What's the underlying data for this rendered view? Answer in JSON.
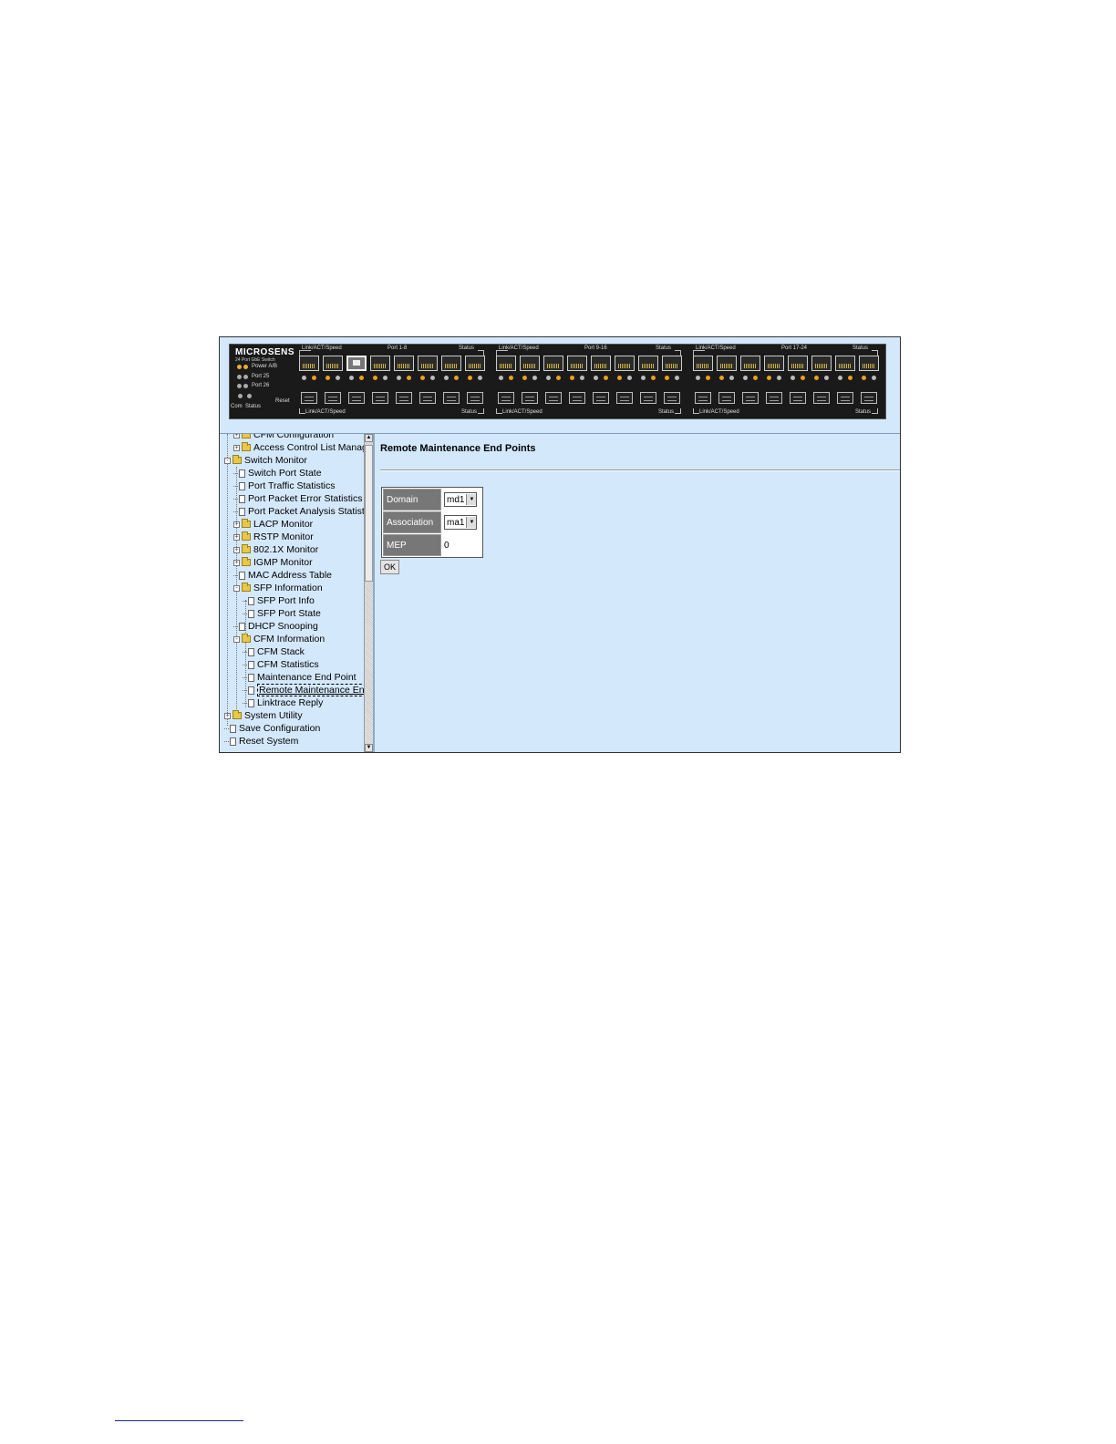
{
  "banner": {
    "brand": "MICROSENS",
    "subtitle": "24 Port GbE Switch",
    "power_label": "Power A/B",
    "port25_label": "Port 25",
    "port26_label": "Port 26",
    "com_label": "Com",
    "status_label": "Status",
    "reset_label": "Reset",
    "groups": [
      {
        "top_left": "Link/ACT/Speed",
        "top_center": "Port 1-8",
        "top_right": "Status",
        "bottom_left": "Link/ACT/Speed",
        "bottom_right": "Status"
      },
      {
        "top_left": "Link/ACT/Speed",
        "top_center": "Port 9-16",
        "top_right": "Status",
        "bottom_left": "Link/ACT/Speed",
        "bottom_right": "Status"
      },
      {
        "top_left": "Link/ACT/Speed",
        "top_center": "Port 17-24",
        "top_right": "Status",
        "bottom_left": "Link/ACT/Speed",
        "bottom_right": "Status"
      }
    ]
  },
  "tree": {
    "items": [
      {
        "label": "CFM Configuration",
        "type": "folder",
        "expander": "+"
      },
      {
        "label": "Access Control List Manage",
        "type": "folder",
        "expander": "+"
      },
      {
        "label": "Switch Monitor",
        "type": "folder",
        "expander": "-"
      },
      {
        "label": "Switch Port State",
        "type": "page"
      },
      {
        "label": "Port Traffic Statistics",
        "type": "page"
      },
      {
        "label": "Port Packet Error Statistics",
        "type": "page"
      },
      {
        "label": "Port Packet Analysis Statist",
        "type": "page"
      },
      {
        "label": "LACP Monitor",
        "type": "folder",
        "expander": "+"
      },
      {
        "label": "RSTP Monitor",
        "type": "folder",
        "expander": "+"
      },
      {
        "label": "802.1X Monitor",
        "type": "folder",
        "expander": "+"
      },
      {
        "label": "IGMP Monitor",
        "type": "folder",
        "expander": "+"
      },
      {
        "label": "MAC Address Table",
        "type": "page"
      },
      {
        "label": "SFP Information",
        "type": "folder",
        "expander": "-"
      },
      {
        "label": "SFP Port Info",
        "type": "page"
      },
      {
        "label": "SFP Port State",
        "type": "page"
      },
      {
        "label": "DHCP Snooping",
        "type": "page"
      },
      {
        "label": "CFM Information",
        "type": "folder",
        "expander": "-"
      },
      {
        "label": "CFM Stack",
        "type": "page"
      },
      {
        "label": "CFM Statistics",
        "type": "page"
      },
      {
        "label": "Maintenance End Point",
        "type": "page"
      },
      {
        "label": "Remote Maintenance End",
        "type": "page",
        "active": true
      },
      {
        "label": "Linktrace Reply",
        "type": "page"
      },
      {
        "label": "System Utility",
        "type": "folder",
        "expander": "+"
      },
      {
        "label": "Save Configuration",
        "type": "page"
      },
      {
        "label": "Reset System",
        "type": "page"
      }
    ]
  },
  "content": {
    "title": "Remote Maintenance End Points",
    "form": {
      "domain_label": "Domain",
      "domain_value": "md1",
      "association_label": "Association",
      "association_value": "ma1",
      "mep_label": "MEP",
      "mep_value": "0"
    },
    "ok_label": "OK"
  },
  "colors": {
    "background": "#d4e8fb",
    "label_cell": "#777777",
    "panel": "#1a1a1a"
  }
}
